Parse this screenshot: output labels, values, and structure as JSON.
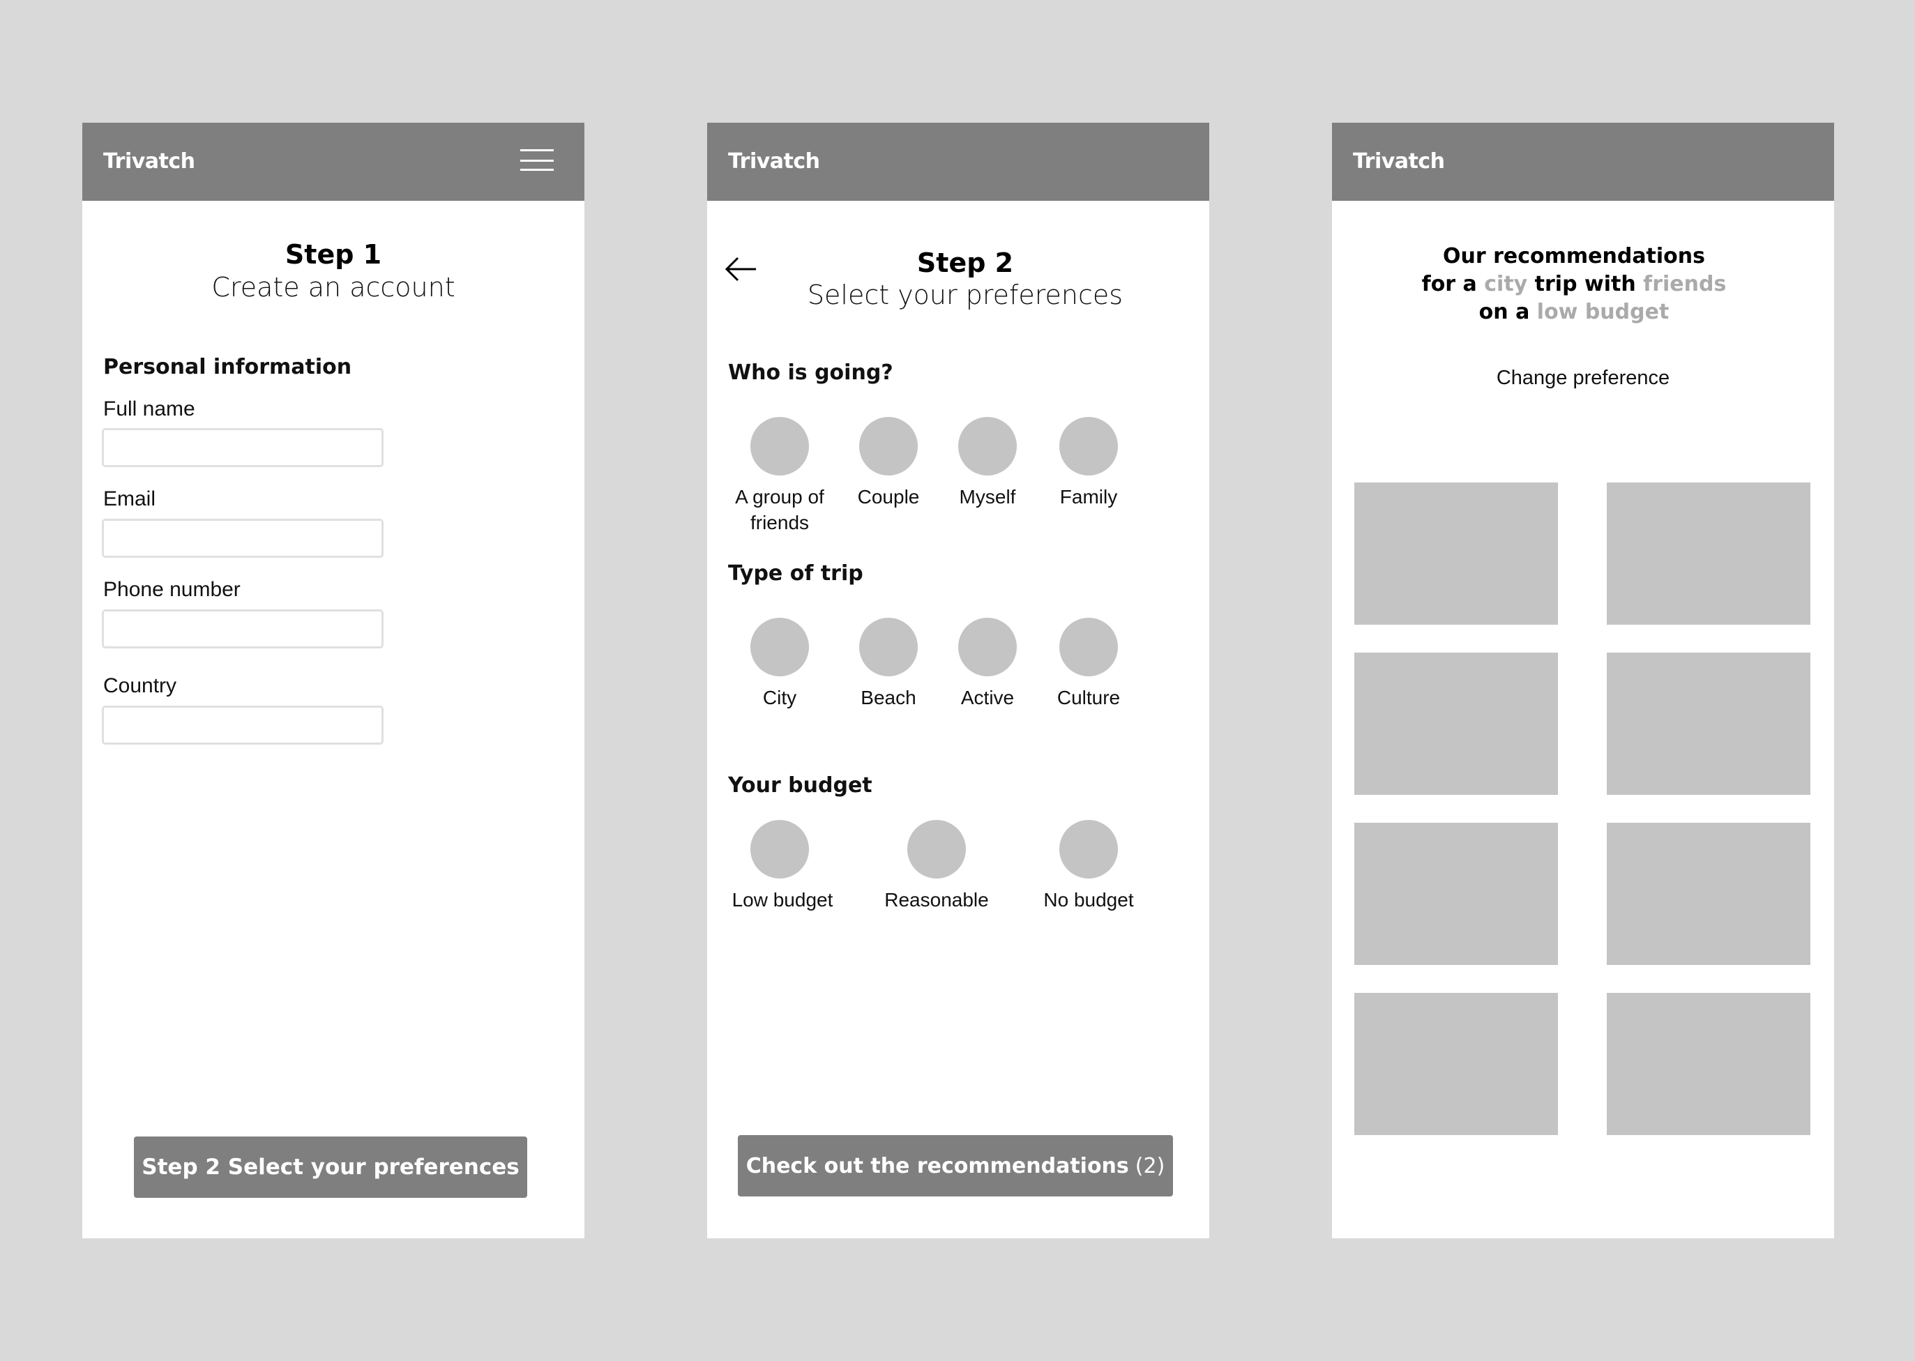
{
  "app": {
    "brand": "Trivatch",
    "colors": {
      "background": "#d9d9d9",
      "header": "#7f7f7f",
      "placeholder": "#c4c4c4",
      "highlight_text": "#aaaaaa",
      "input_border": "#e0e0e0"
    }
  },
  "screen1": {
    "header": {
      "brand": "Trivatch",
      "menu_icon": "hamburger-menu-icon"
    },
    "step_title": "Step 1",
    "step_subtitle": "Create an account",
    "section_title": "Personal information",
    "fields": [
      {
        "label": "Full name",
        "value": "",
        "placeholder": ""
      },
      {
        "label": "Email",
        "value": "",
        "placeholder": ""
      },
      {
        "label": "Phone number",
        "value": "",
        "placeholder": ""
      },
      {
        "label": "Country",
        "value": "",
        "placeholder": ""
      }
    ],
    "next_button": "Step 2 Select your preferences"
  },
  "screen2": {
    "header": {
      "brand": "Trivatch"
    },
    "back_icon": "arrow-left-icon",
    "step_title": "Step 2",
    "step_subtitle": "Select your preferences",
    "groups": [
      {
        "title": "Who is going?",
        "options": [
          "A group of friends",
          "Couple",
          "Myself",
          "Family"
        ]
      },
      {
        "title": "Type of trip",
        "options": [
          "City",
          "Beach",
          "Active",
          "Culture"
        ]
      },
      {
        "title": "Your budget",
        "options": [
          "Low budget",
          "Reasonable",
          "No budget"
        ]
      }
    ],
    "submit_button": {
      "label": "Check out the recommendations",
      "count": "(2)"
    }
  },
  "screen3": {
    "header": {
      "brand": "Trivatch"
    },
    "heading": {
      "line1": "Our recommendations",
      "line2_prefix": "for a",
      "trip_type": "city",
      "line2_middle": "trip with",
      "company": "friends",
      "line3_prefix": "on a",
      "budget": "low budget"
    },
    "change_preference": "Change preference",
    "recommendation_count": 8
  }
}
